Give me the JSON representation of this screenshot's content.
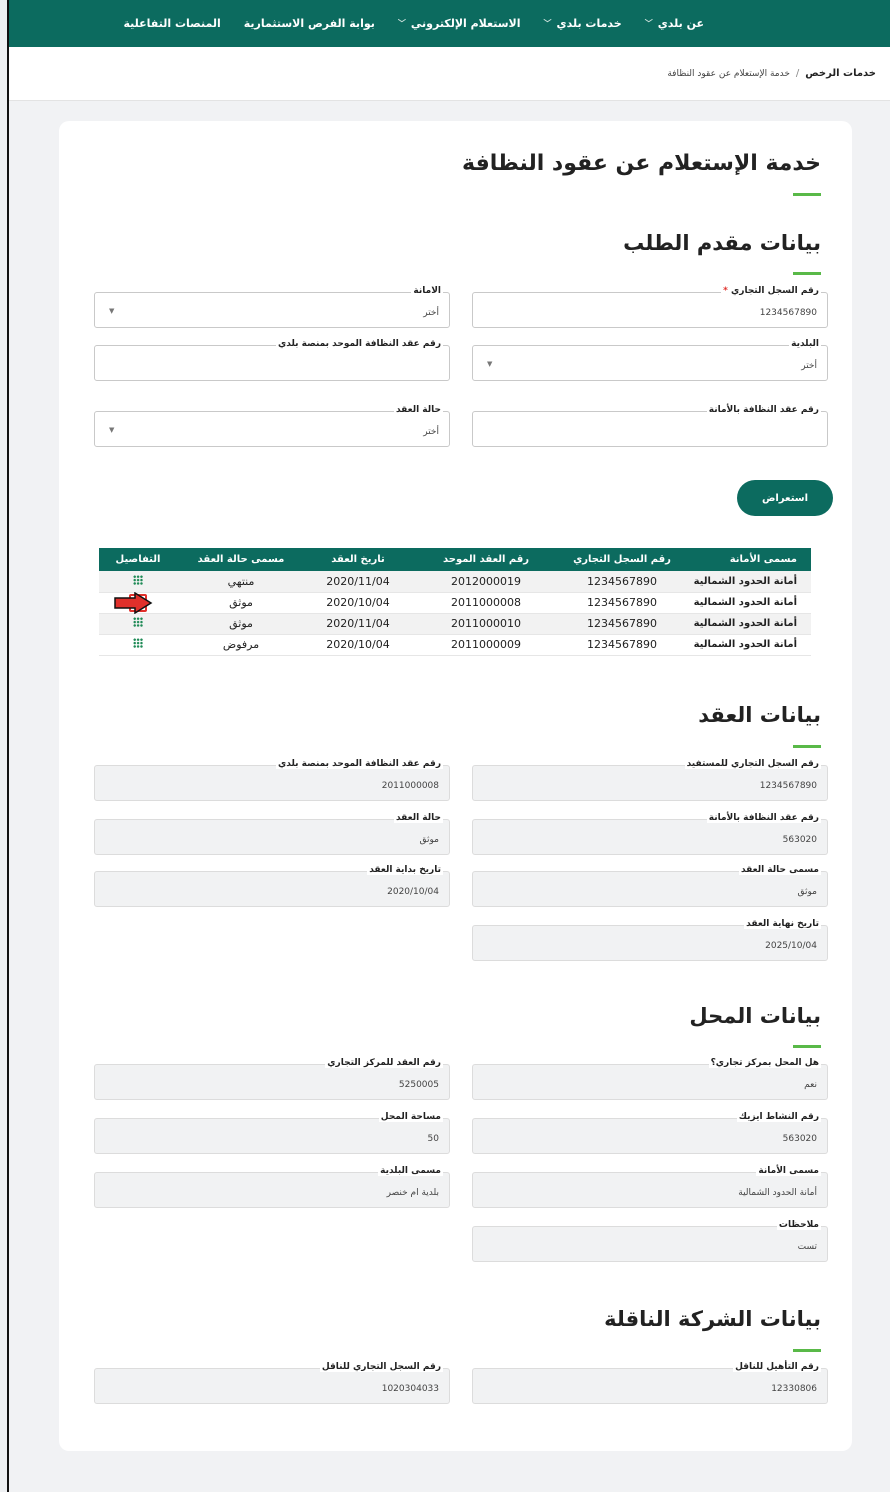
{
  "nav": {
    "items": [
      {
        "label": "عن بلدي",
        "dropdown": true
      },
      {
        "label": "خدمات بلدي",
        "dropdown": true
      },
      {
        "label": "الاستعلام الإلكتروني",
        "dropdown": true
      },
      {
        "label": "بوابة الفرص الاستثمارية",
        "dropdown": false
      },
      {
        "label": "المنصات التفاعلية",
        "dropdown": false
      }
    ]
  },
  "breadcrumb": {
    "main": "خدمات الرخص",
    "sep": "/",
    "current": "خدمة الإستعلام عن عقود النظافة"
  },
  "page_title": "خدمة الإستعلام عن عقود النظافة",
  "applicant": {
    "heading": "بيانات مقدم الطلب",
    "commercial_reg": {
      "label": "رقم السجل التجاري",
      "required": "*",
      "value": "1234567890"
    },
    "amana": {
      "label": "الامانة",
      "value": "أختر"
    },
    "baladiya": {
      "label": "البلدية",
      "value": "أختر"
    },
    "unified_contract": {
      "label": "رقم عقد النظافة الموحد بمنصة بلدي",
      "value": ""
    },
    "amana_contract": {
      "label": "رقم عقد النظافة بالأمانة",
      "value": ""
    },
    "contract_status": {
      "label": "حالة العقد",
      "value": "أختر"
    },
    "submit_label": "استعراض"
  },
  "results": {
    "headers": [
      "مسمى الأمانة",
      "رقم السجل التجاري",
      "رقم العقد الموحد",
      "تاريخ العقد",
      "مسمى حالة العقد",
      "التفاصيل"
    ],
    "rows": [
      {
        "amana": "أمانة الحدود الشمالية",
        "cr": "1234567890",
        "unified": "2012000019",
        "date": "2020/11/04",
        "status": "منتهي"
      },
      {
        "amana": "أمانة الحدود الشمالية",
        "cr": "1234567890",
        "unified": "2011000008",
        "date": "2020/10/04",
        "status": "موثق"
      },
      {
        "amana": "أمانة الحدود الشمالية",
        "cr": "1234567890",
        "unified": "2011000010",
        "date": "2020/11/04",
        "status": "موثق"
      },
      {
        "amana": "أمانة الحدود الشمالية",
        "cr": "1234567890",
        "unified": "2011000009",
        "date": "2020/10/04",
        "status": "مرفوض"
      }
    ]
  },
  "contract": {
    "heading": "بيانات العقد",
    "beneficiary_cr": {
      "label": "رقم السجل التجاري للمستفيد",
      "value": "1234567890"
    },
    "unified_no": {
      "label": "رقم عقد النظافة الموحد بمنصة بلدي",
      "value": "2011000008"
    },
    "amana_no": {
      "label": "رقم عقد النظافة بالأمانة",
      "value": "563020"
    },
    "status": {
      "label": "حالة العقد",
      "value": "موثق"
    },
    "status_name": {
      "label": "مسمى حالة العقد",
      "value": "موثق"
    },
    "start_date": {
      "label": "تاريخ بداية العقد",
      "value": "2020/10/04"
    },
    "end_date": {
      "label": "تاريخ نهاية العقد",
      "value": "2025/10/04"
    }
  },
  "shop": {
    "heading": "بيانات المحل",
    "in_mall": {
      "label": "هل المحل بمركز تجاري؟",
      "value": "نعم"
    },
    "mall_contract": {
      "label": "رقم العقد للمركز التجاري",
      "value": "5250005"
    },
    "isic": {
      "label": "رقم النشاط ايزيك",
      "value": "563020"
    },
    "area": {
      "label": "مساحة المحل",
      "value": "50"
    },
    "amana_name": {
      "label": "مسمى الأمانة",
      "value": "أمانة الحدود الشمالية"
    },
    "baladiya_name": {
      "label": "مسمى البلدية",
      "value": "بلدية ام خنصر"
    },
    "notes": {
      "label": "ملاحظات",
      "value": "تست"
    }
  },
  "carrier": {
    "heading": "بيانات الشركة الناقلة",
    "insurance": {
      "label": "رقم التأهيل للناقل",
      "value": "12330806"
    },
    "cr": {
      "label": "رقم السجل التجاري للناقل",
      "value": "1020304033"
    }
  },
  "colors": {
    "primary": "#0c6b5f",
    "accent": "#59b948",
    "required": "#e0302b",
    "highlight": "#e0302b"
  }
}
